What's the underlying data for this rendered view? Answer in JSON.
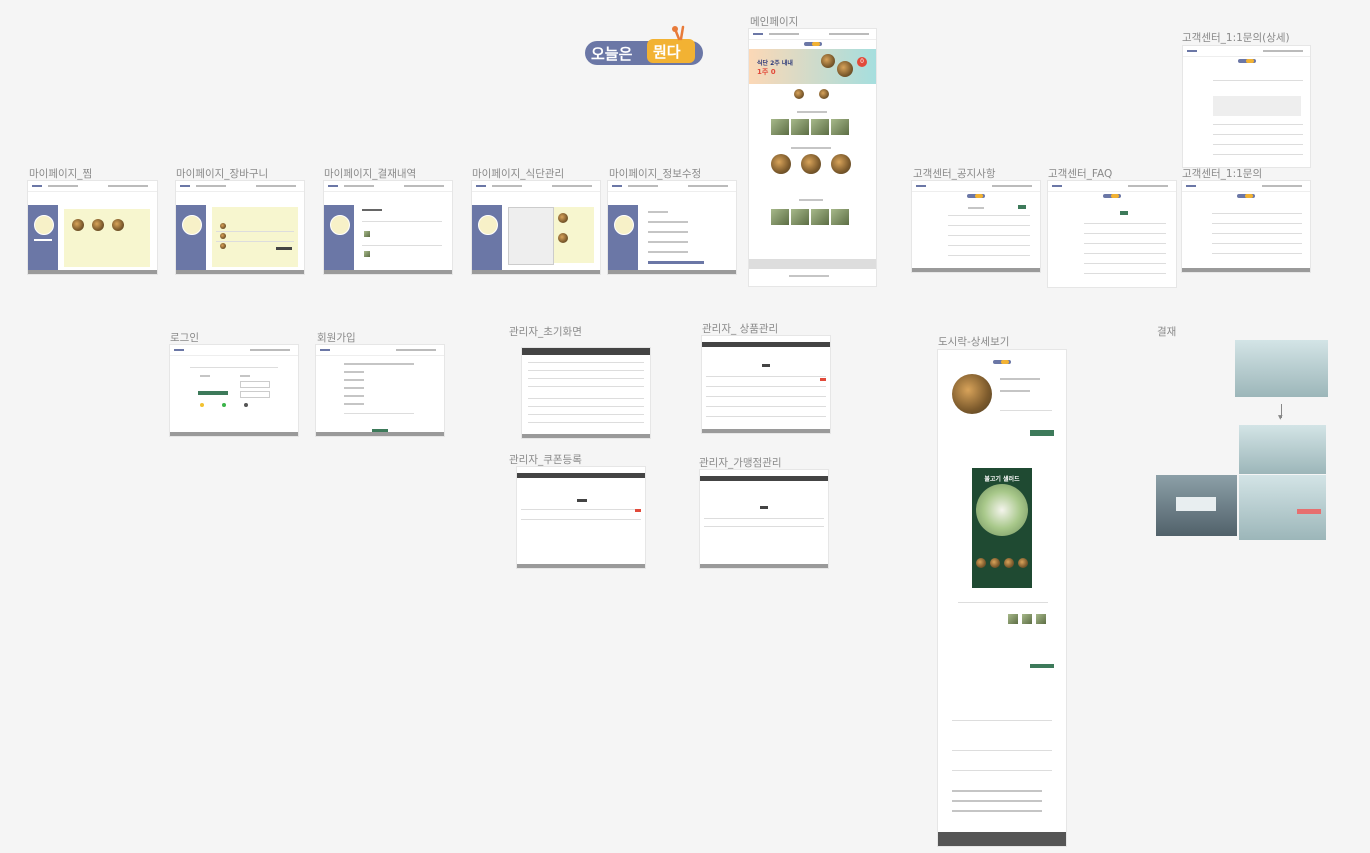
{
  "brand": {
    "logo_text": "오늘은 뭔다",
    "colors": {
      "navy": "#6b77a6",
      "yellow": "#f2b233",
      "green": "#3d7a5a",
      "pale_yellow": "#f7f6cf"
    }
  },
  "frames": {
    "main": "메인페이지",
    "mypage_jjim": "마이페이지_찜",
    "mypage_cart": "마이페이지_장바구니",
    "mypage_payment": "마이페이지_결재내역",
    "mypage_diet": "마이페이지_식단관리",
    "mypage_info": "마이페이지_정보수정",
    "cs_notice": "고객센터_공지사항",
    "cs_faq": "고객센터_FAQ",
    "cs_inquiry": "고객센터_1:1문의",
    "cs_inquiry_detail": "고객센터_1:1문의(상세)",
    "login": "로그인",
    "signup": "회원가입",
    "admin_home": "관리자_초기화면",
    "admin_product": "관리자_ 상품관리",
    "admin_coupon": "관리자_쿠폰등록",
    "admin_franchise": "관리자_가맹점관리",
    "lunchbox_detail": "도시락-상세보기",
    "payment": "결재"
  },
  "main_banner": {
    "line1": "식단 2주 내내",
    "line2": "1주 0",
    "badge": "0"
  },
  "detail_banner": {
    "title": "불고기 샐러드"
  }
}
